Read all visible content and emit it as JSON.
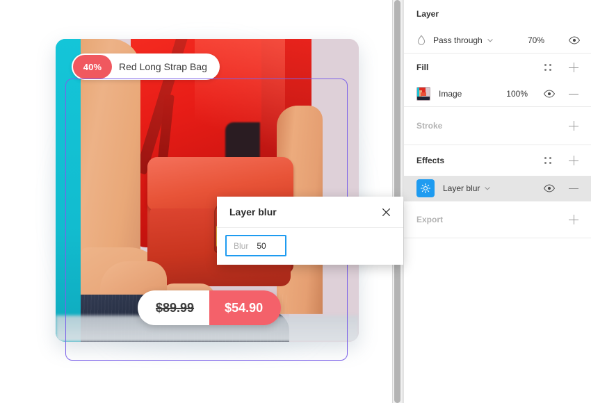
{
  "canvas": {
    "card": {
      "badge": {
        "discount": "40%",
        "title": "Red Long Strap Bag"
      },
      "price": {
        "old": "$89.99",
        "new": "$54.90"
      },
      "colors": {
        "accent_teal": "#17c3d6",
        "accent_coral": "#f0585f",
        "selection": "#7b61e8"
      }
    }
  },
  "panel": {
    "layer": {
      "title": "Layer",
      "blend_mode": "Pass through",
      "opacity": "70%",
      "blend_icon": "blend-mode-icon",
      "chevron_icon": "chevron-down-icon",
      "visibility_icon": "eye-icon"
    },
    "fill": {
      "title": "Fill",
      "reorder_icon": "drag-dots-icon",
      "add_icon": "plus-icon",
      "items": [
        {
          "thumb": "image-thumbnail",
          "label": "Image",
          "opacity": "100%",
          "visibility_icon": "eye-icon",
          "remove_icon": "minus-icon"
        }
      ]
    },
    "stroke": {
      "title": "Stroke",
      "add_icon": "plus-icon"
    },
    "effects": {
      "title": "Effects",
      "reorder_icon": "drag-dots-icon",
      "add_icon": "plus-icon",
      "items": [
        {
          "icon": "layer-blur-icon",
          "label": "Layer blur",
          "chevron_icon": "chevron-down-icon",
          "visibility_icon": "eye-icon",
          "remove_icon": "minus-icon",
          "selected": true
        }
      ]
    },
    "export": {
      "title": "Export",
      "add_icon": "plus-icon"
    }
  },
  "dialog": {
    "title": "Layer blur",
    "close_icon": "close-icon",
    "field": {
      "label": "Blur",
      "value": "50"
    },
    "accent_color": "#1e9bf0"
  }
}
